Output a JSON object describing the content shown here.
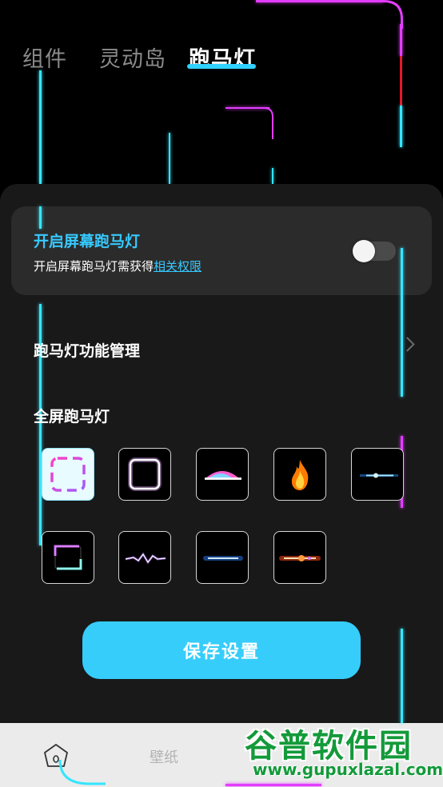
{
  "tabs": [
    {
      "label": "组件"
    },
    {
      "label": "灵动岛"
    },
    {
      "label": "跑马灯"
    }
  ],
  "active_tab": "跑马灯",
  "screen_marquee_card": {
    "title": "开启屏幕跑马灯",
    "desc_prefix": "开启屏幕跑马灯需获得",
    "desc_link": "相关权限",
    "toggle_on": false
  },
  "function_management": {
    "label": "跑马灯功能管理"
  },
  "fullscreen_section": {
    "title": "全屏跑马灯",
    "effects": [
      {
        "name": "dashed-gradient-frame",
        "selected": true
      },
      {
        "name": "white-glow-frame",
        "selected": false
      },
      {
        "name": "rainbow-dome",
        "selected": false
      },
      {
        "name": "fire",
        "selected": false
      },
      {
        "name": "blue-light-streak",
        "selected": false
      },
      {
        "name": "corner-glow-frame",
        "selected": false
      },
      {
        "name": "purple-lightning",
        "selected": false
      },
      {
        "name": "blue-beam",
        "selected": false
      },
      {
        "name": "orange-spark-beam",
        "selected": false
      }
    ]
  },
  "save_button": {
    "label": "保存设置"
  },
  "bottom_nav": {
    "items": [
      {
        "label": "",
        "icon": "home-icon"
      },
      {
        "label": "壁纸",
        "icon": ""
      }
    ]
  },
  "watermark": {
    "title": "谷普软件园",
    "url": "www.gupuxlazal.com"
  },
  "colors": {
    "accent": "#36cdfb",
    "marquee_cyan": "#35e5ff",
    "marquee_pink": "#e23dff",
    "marquee_red": "#e3192c",
    "panel_bg": "#191919",
    "card_bg": "#2b2b2b",
    "watermark_green": "#139a3a"
  }
}
